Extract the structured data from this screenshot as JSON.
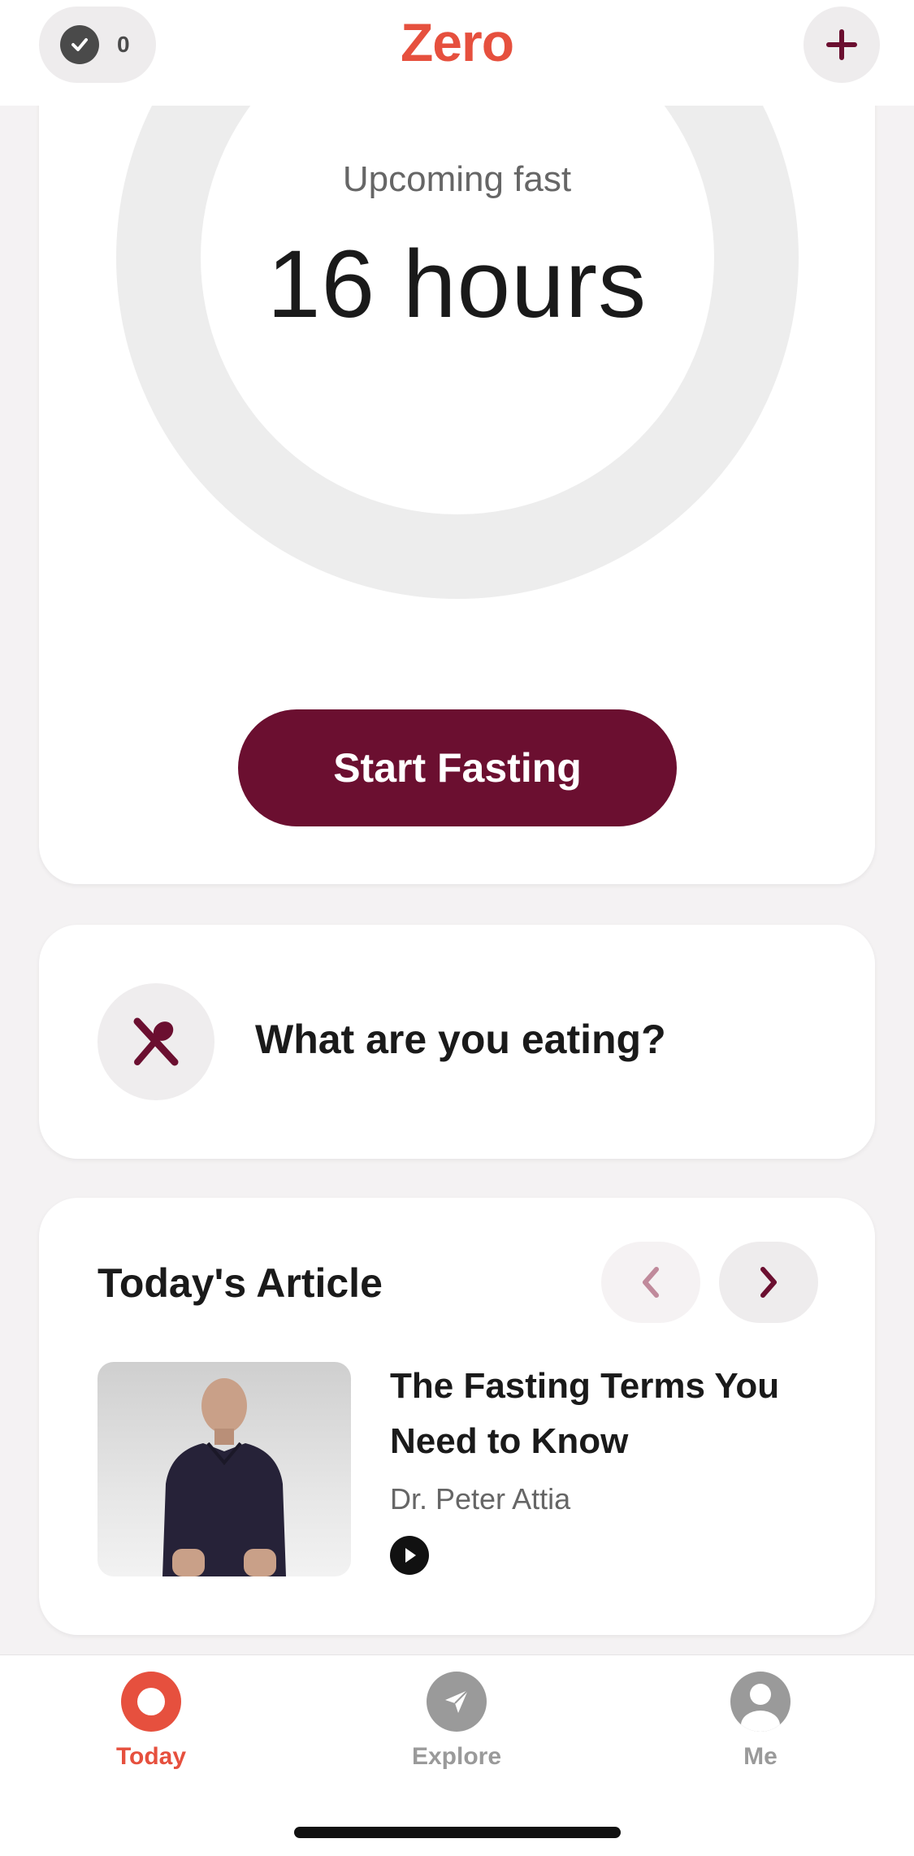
{
  "header": {
    "streak_count": "0",
    "logo": "Zero"
  },
  "timer": {
    "label": "Upcoming fast",
    "value": "16 hours",
    "start_button": "Start Fasting"
  },
  "eating": {
    "prompt": "What are you eating?"
  },
  "article": {
    "heading": "Today's Article",
    "title": "The Fasting Terms You Need to Know",
    "author": "Dr. Peter Attia"
  },
  "tabs": [
    {
      "label": "Today",
      "icon": "circle-icon",
      "active": true
    },
    {
      "label": "Explore",
      "icon": "compass-icon",
      "active": false
    },
    {
      "label": "Me",
      "icon": "user-icon",
      "active": false
    }
  ],
  "colors": {
    "brand": "#e6503e",
    "primary": "#6b0f30",
    "inactive": "#9a9a9a"
  }
}
